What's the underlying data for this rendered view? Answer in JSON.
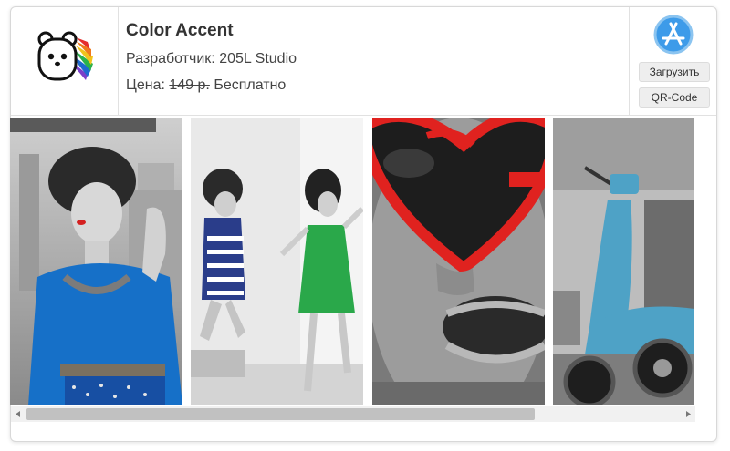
{
  "app": {
    "title": "Color Accent",
    "developer_label": "Разработчик:",
    "developer": "205L Studio",
    "price_label": "Цена:",
    "old_price": "149 р.",
    "price": "Бесплатно",
    "icon": "bear-rainbow-logo"
  },
  "actions": {
    "store_icon": "app-store-icon",
    "download_label": "Загрузить",
    "qr_label": "QR-Code"
  },
  "gallery": {
    "screenshots": [
      {
        "name": "retro-woman-blue-dress",
        "accent": "#1670c8"
      },
      {
        "name": "jumping-girls-striped-green",
        "accent": "#2aa84a"
      },
      {
        "name": "red-heart-sunglasses",
        "accent": "#e0221f"
      },
      {
        "name": "blue-scooter",
        "accent": "#4ea2c6"
      }
    ]
  },
  "scrollbar": {
    "left_arrow": "◀",
    "right_arrow": "▶",
    "position": 0.0
  }
}
